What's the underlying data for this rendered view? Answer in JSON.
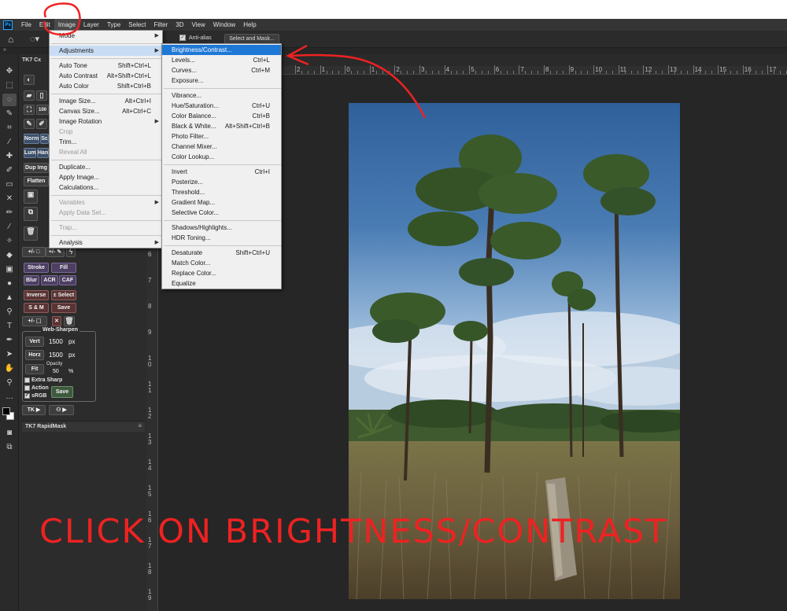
{
  "app": {
    "logo_text": "Ps"
  },
  "menubar": [
    "File",
    "Edit",
    "Image",
    "Layer",
    "Type",
    "Select",
    "Filter",
    "3D",
    "View",
    "Window",
    "Help"
  ],
  "options_bar": {
    "anti_alias_label": "Anti-alias",
    "anti_alias_checked": true,
    "select_mask_label": "Select and Mask..."
  },
  "image_menu": {
    "items": [
      {
        "label": "Mode",
        "submenu": true
      },
      {
        "sep": true
      },
      {
        "label": "Adjustments",
        "submenu": true,
        "state": "hover"
      },
      {
        "sep": true
      },
      {
        "label": "Auto Tone",
        "shortcut": "Shift+Ctrl+L"
      },
      {
        "label": "Auto Contrast",
        "shortcut": "Alt+Shift+Ctrl+L"
      },
      {
        "label": "Auto Color",
        "shortcut": "Shift+Ctrl+B"
      },
      {
        "sep": true
      },
      {
        "label": "Image Size...",
        "shortcut": "Alt+Ctrl+I"
      },
      {
        "label": "Canvas Size...",
        "shortcut": "Alt+Ctrl+C"
      },
      {
        "label": "Image Rotation",
        "submenu": true
      },
      {
        "label": "Crop",
        "disabled": true
      },
      {
        "label": "Trim..."
      },
      {
        "label": "Reveal All",
        "disabled": true
      },
      {
        "sep": true
      },
      {
        "label": "Duplicate..."
      },
      {
        "label": "Apply Image..."
      },
      {
        "label": "Calculations..."
      },
      {
        "sep": true
      },
      {
        "label": "Variables",
        "submenu": true,
        "disabled": true
      },
      {
        "label": "Apply Data Set...",
        "disabled": true
      },
      {
        "sep": true
      },
      {
        "label": "Trap...",
        "disabled": true
      },
      {
        "sep": true
      },
      {
        "label": "Analysis",
        "submenu": true
      }
    ]
  },
  "adjustments_menu": {
    "items": [
      {
        "label": "Brightness/Contrast...",
        "state": "highlighted"
      },
      {
        "label": "Levels...",
        "shortcut": "Ctrl+L"
      },
      {
        "label": "Curves...",
        "shortcut": "Ctrl+M"
      },
      {
        "label": "Exposure..."
      },
      {
        "sep": true
      },
      {
        "label": "Vibrance..."
      },
      {
        "label": "Hue/Saturation...",
        "shortcut": "Ctrl+U"
      },
      {
        "label": "Color Balance...",
        "shortcut": "Ctrl+B"
      },
      {
        "label": "Black & White...",
        "shortcut": "Alt+Shift+Ctrl+B"
      },
      {
        "label": "Photo Filter..."
      },
      {
        "label": "Channel Mixer..."
      },
      {
        "label": "Color Lookup..."
      },
      {
        "sep": true
      },
      {
        "label": "Invert",
        "shortcut": "Ctrl+I"
      },
      {
        "label": "Posterize..."
      },
      {
        "label": "Threshold..."
      },
      {
        "label": "Gradient Map..."
      },
      {
        "label": "Selective Color..."
      },
      {
        "sep": true
      },
      {
        "label": "Shadows/Highlights..."
      },
      {
        "label": "HDR Toning..."
      },
      {
        "sep": true
      },
      {
        "label": "Desaturate",
        "shortcut": "Shift+Ctrl+U"
      },
      {
        "label": "Match Color..."
      },
      {
        "label": "Replace Color..."
      },
      {
        "label": "Equalize"
      }
    ]
  },
  "tk_panel": {
    "tab_title": "TK7 Cx",
    "buttons": {
      "norm": "Norm",
      "sc": "Sc",
      "lum": "Lum",
      "han": "Han",
      "dup_img": "Dup Img",
      "flatten": "Flatten",
      "stroke": "Stroke",
      "fill": "Fill",
      "blur": "Blur",
      "acr": "ACR",
      "caf": "CAF",
      "inverse": "Inverse",
      "plus_select": "± Select",
      "s_and_m": "S & M",
      "save": "Save",
      "fit": "Fit",
      "save2": "Save",
      "tk": "TK ▶",
      "zoom_pct": "100"
    },
    "web_sharpen": {
      "title": "Web-Sharpen",
      "vert_label": "Vert",
      "vert_value": "1500",
      "vert_unit": "px",
      "horz_label": "Horz",
      "horz_value": "1500",
      "horz_unit": "px",
      "opacity_label": "Opacity",
      "opacity_value": "50",
      "opacity_unit": "%",
      "extra_sharp": "Extra Sharp",
      "action": "Action",
      "srgb": "sRGB",
      "srgb_checked": true
    },
    "rapidmask_title": "TK7 RapidMask"
  },
  "rulers": {
    "horizontal": [
      "2",
      "1",
      "0",
      "1",
      "2",
      "3",
      "4",
      "5",
      "6",
      "7",
      "8",
      "9",
      "10",
      "11",
      "12",
      "13",
      "14",
      "15",
      "16",
      "17"
    ],
    "vertical": [
      "6",
      "7",
      "8",
      "9",
      "1\n0",
      "1\n1",
      "1\n2",
      "1\n3",
      "1\n4",
      "1\n5",
      "1\n6",
      "1\n7",
      "1\n8",
      "1\n9"
    ]
  },
  "annotation": {
    "caption": "CLICK ON BRIGHTNESS/CONTRAST",
    "color": "#ee2222"
  },
  "colors": {
    "highlight": "#1e78d6",
    "menu_bg": "#f0f0f0",
    "ui_dark": "#2c2c2c"
  }
}
